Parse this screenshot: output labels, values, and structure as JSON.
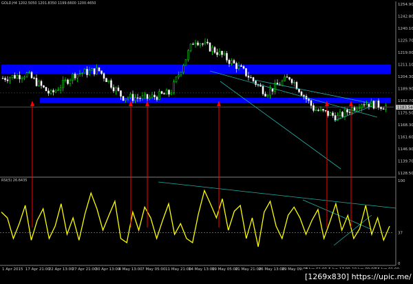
{
  "header": {
    "symbol_line": "GOLD,H4 1202.5050 1201.8350 1199.6600 1200.4650",
    "rsi_label": "RSI(5) 26.6435"
  },
  "watermark": "[1269x830] https://upic.me/",
  "price_axis": {
    "ticks": [
      "1254.90",
      "1242.80",
      "1240.10",
      "1225.70",
      "1219.00",
      "1211.10",
      "1204.30",
      "1189.90",
      "1182.70",
      "1175.50",
      "1168.30",
      "1161.60",
      "1146.90",
      "1139.70",
      "1128.50"
    ],
    "last_price_label": "1183.54"
  },
  "rsi_axis": {
    "ticks": [
      "100",
      "37",
      "0"
    ]
  },
  "time_axis": {
    "ticks": [
      "1 Apr 2015",
      "17 Apr 21:00",
      "22 Apr 13:00",
      "27 Apr 21:00",
      "30 Apr 13:00",
      "4 May 13:00",
      "7 May 05:00",
      "11 May 21:00",
      "14 May 13:00",
      "19 May 05:00",
      "21 May 21:00",
      "26 May 13:00",
      "29 May 09:00",
      "3 Jun 01:00",
      "5 Jun 17:00",
      "10 Jun 09:00",
      "15 Jun 01:00"
    ]
  },
  "colors": {
    "background": "#000000",
    "bull_candle": "#00ff00",
    "bear_candle": "#ffffff",
    "zone": "#0000ff",
    "arrow": "#ff0000",
    "rsi_line": "#ffff00",
    "trendline": "#20b2aa"
  },
  "chart_data": {
    "type": "line",
    "title": "",
    "price_range": [
      1128.5,
      1257
    ],
    "price_series": {
      "x": [
        "1 Apr 2015",
        "17 Apr 21:00",
        "22 Apr 13:00",
        "27 Apr 21:00",
        "30 Apr 13:00",
        "4 May 13:00",
        "7 May 05:00",
        "11 May 21:00",
        "14 May 13:00",
        "19 May 05:00",
        "21 May 21:00",
        "26 May 13:00",
        "29 May 09:00",
        "3 Jun 01:00",
        "5 Jun 17:00",
        "10 Jun 09:00",
        "15 Jun 01:00"
      ],
      "values": [
        1201,
        1204,
        1189,
        1204,
        1207,
        1187,
        1186,
        1190,
        1230,
        1220,
        1207,
        1190,
        1202,
        1178,
        1172,
        1183,
        1180
      ]
    },
    "zones": [
      {
        "low": 1204.3,
        "high": 1211.1
      },
      {
        "low": 1182.7,
        "high": 1186.5
      }
    ],
    "rsi": {
      "name": "RSI(5)",
      "last": 26.6435,
      "ylim": [
        0,
        100
      ],
      "level": 37,
      "values": [
        62,
        55,
        30,
        48,
        70,
        28,
        52,
        66,
        30,
        45,
        72,
        35,
        55,
        28,
        60,
        85,
        66,
        40,
        58,
        75,
        30,
        25,
        62,
        40,
        68,
        55,
        30,
        52,
        72,
        35,
        48,
        30,
        25,
        60,
        88,
        72,
        55,
        78,
        40,
        63,
        70,
        30,
        55,
        20,
        62,
        75,
        45,
        30,
        58,
        68,
        55,
        35,
        52,
        65,
        30,
        50,
        72,
        40,
        58,
        30,
        42,
        70,
        35,
        55,
        28,
        45
      ]
    },
    "arrows_at": [
      "17 Apr 21:00",
      "7 May 05:00",
      "7 May 05:00",
      "21 May 21:00",
      "10 Jun 09:00",
      "15 Jun 01:00"
    ]
  }
}
